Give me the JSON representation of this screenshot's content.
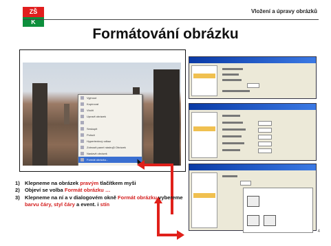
{
  "header": {
    "logo_top": "ZŠ",
    "logo_bottom": "K",
    "title": "Vložení a úpravy obrázků"
  },
  "main_title": "Formátování obrázku",
  "context_menu": {
    "items": [
      "Vyjmout",
      "Kopírovat",
      "Vložit",
      "Upravit obrázek",
      "",
      "Seskupit",
      "Pořadí",
      "Hypertextový odkaz",
      "Zobrazit panel nástrojů Obrázek",
      "Nastavit obrázek",
      "Formát obrázku..."
    ],
    "highlighted_index": 10
  },
  "steps": [
    {
      "num": "1)",
      "parts": [
        {
          "text": "Klepneme na obrázek ",
          "red": false
        },
        {
          "text": "pravým",
          "red": true
        },
        {
          "text": " tlačítkem myši",
          "red": false
        }
      ]
    },
    {
      "num": "2)",
      "parts": [
        {
          "text": "Objeví se volba ",
          "red": false
        },
        {
          "text": "Formát obrázku …",
          "red": true
        }
      ]
    },
    {
      "num": "3)",
      "parts": [
        {
          "text": "Klepneme na ní a v dialogovém okně ",
          "red": false
        },
        {
          "text": "Formát obrázku",
          "red": true
        },
        {
          "text": " vybereme ",
          "red": false
        },
        {
          "text": "barvu čáry, styl čáry",
          "red": true
        },
        {
          "text": " a event. i ",
          "red": false
        },
        {
          "text": "stín",
          "red": true
        }
      ]
    }
  ],
  "page_number": "4",
  "colors": {
    "accent_red": "#e0201a",
    "logo_red": "#e11e1e",
    "logo_green": "#0d8f3c",
    "dialog_blue": "#0a3aa6"
  }
}
